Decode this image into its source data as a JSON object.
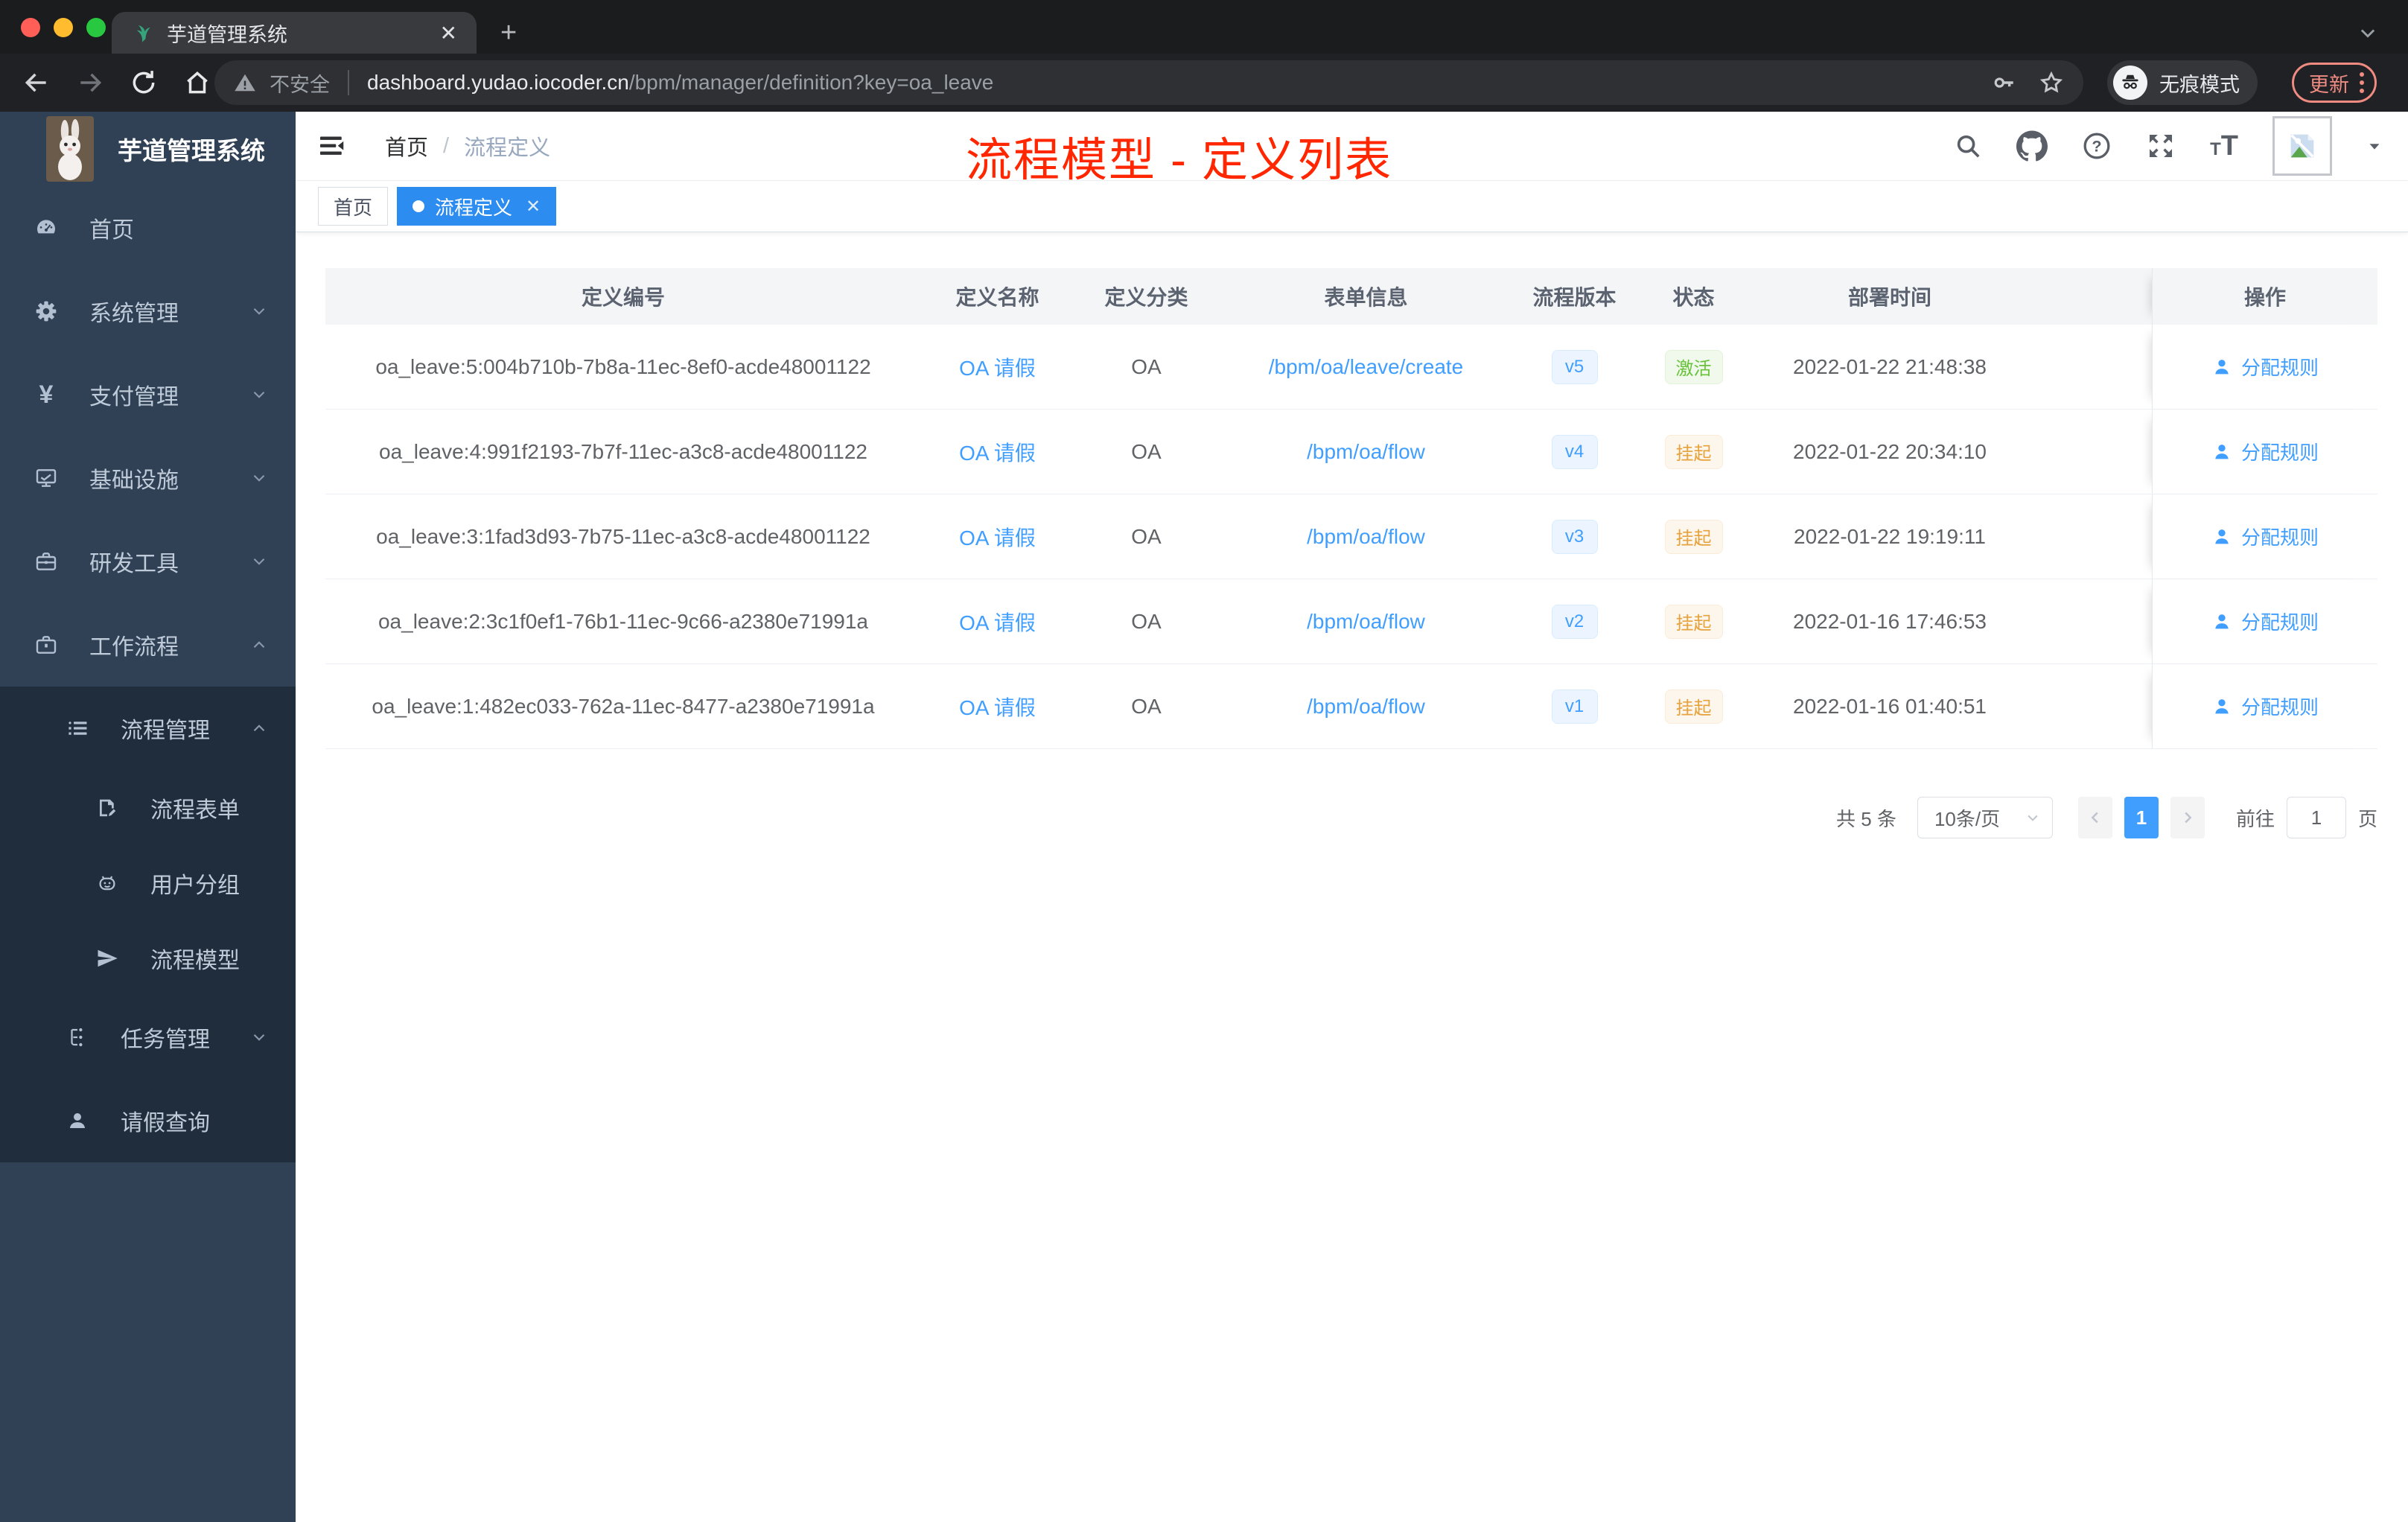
{
  "colors": {
    "accent_blue": "#409eff",
    "tag_active_blue": "#2d8cf0",
    "annotation_red": "#ff2600",
    "sidebar_bg": "#304156",
    "submenu_bg": "#1f2d3d",
    "success_green": "#67c23a",
    "warning_orange": "#e6a23c"
  },
  "browser": {
    "tab_title": "芋道管理系统",
    "tab_close": "✕",
    "new_tab": "+",
    "security_label": "不安全",
    "url_domain": "dashboard.yudao.iocoder.cn",
    "url_path": "/bpm/manager/definition?key=oa_leave",
    "incognito_label": "无痕模式",
    "update_label": "更新"
  },
  "sidebar": {
    "logo_title": "芋道管理系统",
    "items": [
      {
        "label": "首页",
        "icon": "dashboard-icon"
      },
      {
        "label": "系统管理",
        "icon": "gear-icon",
        "chevron": "down"
      },
      {
        "label": "支付管理",
        "icon": "yen-icon",
        "chevron": "down"
      },
      {
        "label": "基础设施",
        "icon": "monitor-icon",
        "chevron": "down"
      },
      {
        "label": "研发工具",
        "icon": "toolbox-icon",
        "chevron": "down"
      },
      {
        "label": "工作流程",
        "icon": "briefcase-icon",
        "chevron": "up"
      }
    ],
    "submenu": [
      {
        "label": "流程管理",
        "icon": "list-icon",
        "chevron": "up",
        "level": 1
      },
      {
        "label": "流程表单",
        "icon": "form-icon",
        "level": 2
      },
      {
        "label": "用户分组",
        "icon": "robot-icon",
        "level": 2
      },
      {
        "label": "流程模型",
        "icon": "send-icon",
        "level": 2
      },
      {
        "label": "任务管理",
        "icon": "tree-icon",
        "chevron": "down",
        "level": 1
      },
      {
        "label": "请假查询",
        "icon": "user-icon",
        "level": 1
      }
    ]
  },
  "header": {
    "breadcrumb_home": "首页",
    "breadcrumb_sep": "/",
    "breadcrumb_current": "流程定义",
    "annotation": "流程模型 - 定义列表"
  },
  "tags": {
    "home": "首页",
    "active": "流程定义",
    "active_close": "✕"
  },
  "table": {
    "columns": {
      "id": "定义编号",
      "name": "定义名称",
      "category": "定义分类",
      "form": "表单信息",
      "version": "流程版本",
      "status": "状态",
      "time": "部署时间",
      "action": "操作"
    },
    "rows": [
      {
        "id": "oa_leave:5:004b710b-7b8a-11ec-8ef0-acde48001122",
        "name": "OA 请假",
        "category": "OA",
        "form": "/bpm/oa/leave/create",
        "version": "v5",
        "status": "激活",
        "status_type": "success",
        "time": "2022-01-22 21:48:38",
        "action": "分配规则"
      },
      {
        "id": "oa_leave:4:991f2193-7b7f-11ec-a3c8-acde48001122",
        "name": "OA 请假",
        "category": "OA",
        "form": "/bpm/oa/flow",
        "version": "v4",
        "status": "挂起",
        "status_type": "warning",
        "time": "2022-01-22 20:34:10",
        "action": "分配规则"
      },
      {
        "id": "oa_leave:3:1fad3d93-7b75-11ec-a3c8-acde48001122",
        "name": "OA 请假",
        "category": "OA",
        "form": "/bpm/oa/flow",
        "version": "v3",
        "status": "挂起",
        "status_type": "warning",
        "time": "2022-01-22 19:19:11",
        "action": "分配规则"
      },
      {
        "id": "oa_leave:2:3c1f0ef1-76b1-11ec-9c66-a2380e71991a",
        "name": "OA 请假",
        "category": "OA",
        "form": "/bpm/oa/flow",
        "version": "v2",
        "status": "挂起",
        "status_type": "warning",
        "time": "2022-01-16 17:46:53",
        "action": "分配规则"
      },
      {
        "id": "oa_leave:1:482ec033-762a-11ec-8477-a2380e71991a",
        "name": "OA 请假",
        "category": "OA",
        "form": "/bpm/oa/flow",
        "version": "v1",
        "status": "挂起",
        "status_type": "warning",
        "time": "2022-01-16 01:40:51",
        "action": "分配规则"
      }
    ]
  },
  "pagination": {
    "total": "共 5 条",
    "page_size": "10条/页",
    "page": "1",
    "goto_label": "前往",
    "goto_value": "1",
    "unit_label": "页"
  }
}
